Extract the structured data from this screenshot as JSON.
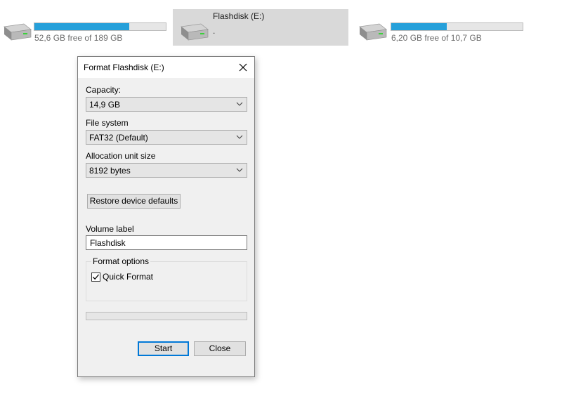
{
  "drives": [
    {
      "name": "",
      "free_text": "52,6 GB free of 189 GB",
      "used_fraction": 0.72,
      "icon": "hard-drive-icon"
    },
    {
      "name": "Flashdisk (E:)",
      "free_text": ".",
      "used_fraction": null,
      "icon": "hard-drive-icon",
      "selected": true
    },
    {
      "name": "",
      "free_text": "6,20 GB free of 10,7 GB",
      "used_fraction": 0.42,
      "icon": "hard-drive-icon"
    }
  ],
  "dialog": {
    "title": "Format Flashdisk (E:)",
    "close_icon": "close-icon",
    "capacity": {
      "label": "Capacity:",
      "value": "14,9 GB"
    },
    "file_system": {
      "label": "File system",
      "value": "FAT32 (Default)"
    },
    "allocation": {
      "label": "Allocation unit size",
      "value": "8192 bytes"
    },
    "restore_button": "Restore device defaults",
    "volume_label": {
      "label": "Volume label",
      "value": "Flashdisk"
    },
    "format_options": {
      "title": "Format options",
      "quick_format": {
        "label": "Quick Format",
        "checked": true
      }
    },
    "progress_fraction": 0,
    "start_button": "Start",
    "close_button": "Close"
  },
  "colors": {
    "accent": "#26a0da",
    "selection": "#d9d9d9",
    "dialog_bg": "#f0f0f0",
    "focus_border": "#0078d7"
  }
}
